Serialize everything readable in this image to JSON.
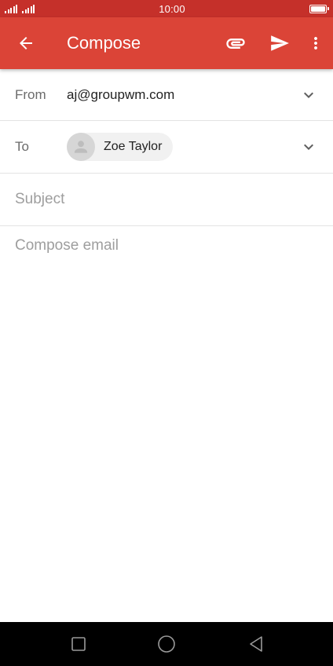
{
  "status_bar": {
    "time": "10:00",
    "icons": [
      "signal-icon",
      "signal-icon",
      "battery-icon"
    ]
  },
  "app_bar": {
    "title": "Compose",
    "icons": [
      "arrow-back-icon",
      "attach-icon",
      "send-icon",
      "more-vert-icon"
    ]
  },
  "from": {
    "label": "From",
    "value": "aj@groupwm.com"
  },
  "to": {
    "label": "To",
    "recipients": [
      {
        "name": "Zoe Taylor"
      }
    ]
  },
  "subject": {
    "value": "",
    "placeholder": "Subject"
  },
  "body": {
    "value": "",
    "placeholder": "Compose email"
  },
  "nav_bar": {
    "icons": [
      "recent-apps-icon",
      "home-icon",
      "back-icon"
    ]
  },
  "colors": {
    "app_bar": "#db4437",
    "status_bar": "#c5302a",
    "nav_bar": "#000000"
  }
}
